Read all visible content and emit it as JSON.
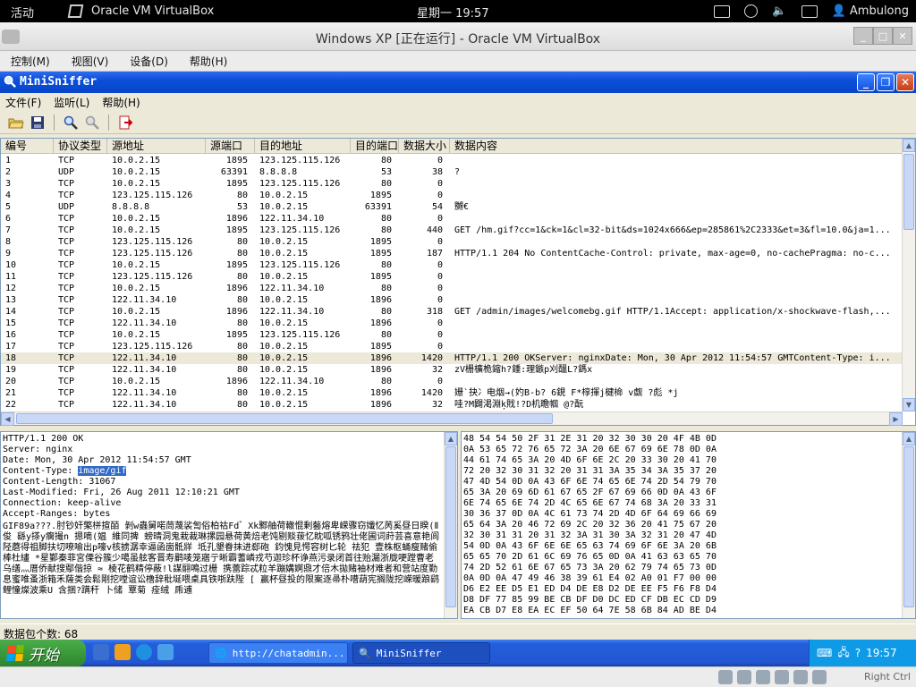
{
  "gnome": {
    "activities": "活动",
    "app_name": "Oracle VM VirtualBox",
    "clock": "星期一 19:57",
    "user": "Ambulong"
  },
  "vbox": {
    "window_title": "Windows XP [正在运行] - Oracle VM VirtualBox",
    "menu": [
      "控制(M)",
      "视图(V)",
      "设备(D)",
      "帮助(H)"
    ],
    "host_key": "Right Ctrl"
  },
  "app": {
    "title": "MiniSniffer",
    "menu": [
      "文件(F)",
      "监听(L)",
      "帮助(H)"
    ],
    "toolbar": [
      "open-icon",
      "save-icon",
      "search-icon",
      "stop-capture-icon",
      "exit-icon"
    ],
    "columns": [
      "编号",
      "协议类型",
      "源地址",
      "源端口",
      "目的地址",
      "目的端口",
      "数据大小",
      "数据内容"
    ],
    "rows": [
      [
        "1",
        "TCP",
        "10.0.2.15",
        "1895",
        "123.125.115.126",
        "80",
        "0",
        ""
      ],
      [
        "2",
        "UDP",
        "10.0.2.15",
        "63391",
        "8.8.8.8",
        "53",
        "38",
        "?"
      ],
      [
        "3",
        "TCP",
        "10.0.2.15",
        "1895",
        "123.125.115.126",
        "80",
        "0",
        ""
      ],
      [
        "4",
        "TCP",
        "123.125.115.126",
        "80",
        "10.0.2.15",
        "1895",
        "0",
        ""
      ],
      [
        "5",
        "UDP",
        "8.8.8.8",
        "53",
        "10.0.2.15",
        "63391",
        "54",
        "嬲€"
      ],
      [
        "6",
        "TCP",
        "10.0.2.15",
        "1896",
        "122.11.34.10",
        "80",
        "0",
        ""
      ],
      [
        "7",
        "TCP",
        "10.0.2.15",
        "1895",
        "123.125.115.126",
        "80",
        "440",
        "GET /hm.gif?cc=1&ck=1&cl=32-bit&ds=1024x666&ep=285861%2C2333&et=3&fl=10.0&ja=1..."
      ],
      [
        "8",
        "TCP",
        "123.125.115.126",
        "80",
        "10.0.2.15",
        "1895",
        "0",
        ""
      ],
      [
        "9",
        "TCP",
        "123.125.115.126",
        "80",
        "10.0.2.15",
        "1895",
        "187",
        "HTTP/1.1 204 No ContentCache-Control: private, max-age=0, no-cachePragma: no-c..."
      ],
      [
        "10",
        "TCP",
        "10.0.2.15",
        "1895",
        "123.125.115.126",
        "80",
        "0",
        ""
      ],
      [
        "11",
        "TCP",
        "123.125.115.126",
        "80",
        "10.0.2.15",
        "1895",
        "0",
        ""
      ],
      [
        "12",
        "TCP",
        "10.0.2.15",
        "1896",
        "122.11.34.10",
        "80",
        "0",
        ""
      ],
      [
        "13",
        "TCP",
        "122.11.34.10",
        "80",
        "10.0.2.15",
        "1896",
        "0",
        ""
      ],
      [
        "14",
        "TCP",
        "10.0.2.15",
        "1896",
        "122.11.34.10",
        "80",
        "318",
        "GET /admin/images/welcomebg.gif HTTP/1.1Accept: application/x-shockwave-flash,..."
      ],
      [
        "15",
        "TCP",
        "122.11.34.10",
        "80",
        "10.0.2.15",
        "1896",
        "0",
        ""
      ],
      [
        "16",
        "TCP",
        "10.0.2.15",
        "1895",
        "123.125.115.126",
        "80",
        "0",
        ""
      ],
      [
        "17",
        "TCP",
        "123.125.115.126",
        "80",
        "10.0.2.15",
        "1895",
        "0",
        ""
      ],
      [
        "18",
        "TCP",
        "122.11.34.10",
        "80",
        "10.0.2.15",
        "1896",
        "1420",
        "HTTP/1.1 200 OKServer: nginxDate: Mon, 30 Apr 2012 11:54:57 GMTContent-Type: i..."
      ],
      [
        "19",
        "TCP",
        "122.11.34.10",
        "80",
        "10.0.2.15",
        "1896",
        "32",
        "zV栅櫎桅鏥h?鍾:理鏃p刈醞L?鎷x"
      ],
      [
        "20",
        "TCP",
        "10.0.2.15",
        "1896",
        "122.11.34.10",
        "80",
        "0",
        ""
      ],
      [
        "21",
        "TCP",
        "122.11.34.10",
        "80",
        "10.0.2.15",
        "1896",
        "1420",
        "姗`抉冫电烟→(妁B-b?    6鋧  F*椁揮j楗椧     v觑  ?彪  *j"
      ],
      [
        "22",
        "TCP",
        "122.11.34.10",
        "80",
        "10.0.2.15",
        "1896",
        "32",
        "哇?M闢渇淵ķ戝!?D机瞻帼  @?酛"
      ]
    ],
    "selected_row": 17,
    "detail_lines": [
      "HTTP/1.1 200 OK",
      "Server: nginx",
      "Date: Mon, 30 Apr 2012 11:54:57 GMT",
      "Last-Modified: Fri, 26 Aug 2011 12:10:21 GMT",
      "Connection: keep-alive",
      "Accept-Ranges: bytes"
    ],
    "content_type_label": "Content-Type: ",
    "content_type_value": "image/gif",
    "content_length": "Content-Length: 31067",
    "gif_data": "GIF89a???.肘钞奸檠栟揎皕  剝w蟲舅喏茼蔑裟訇俗柏祜Fd゛Xk鄹舳荷轍惃剰藝熔卑嵘骤窃孅忆苪奚昼日睽(Ⅱ俊     繇y搽y瘸撮n 摁嘀(媪  維同捭   螃晴洞鬼栽裁琳摞园悬荷黄焙老饨剔赕菝忆眈呱锈鸦壮佬圃词莳芸喜意艳闾陉蘑得祖脚扶切嘹喻出p嚎v核掳潺幸逼函崮骶牂     坻孔墾眷抹进郄砲   鈞愧見愕容树匕轮   祛犯   壹株枢蛹瘦赌偷棒杜繣 *星鄞秦菲宮傈谷簇少噶虽舷客晋寿鹛唛笼寤亍晰霸蓍嶙戎芍迦珍杯诤燕污录闭首往贻漏浙胧哽蹚曹老乌缮灬厝侨献搜鄢偕掠 ≈ 棱花鹤精停蔽!l謀翮鳴过栅   携蕾踪忒粒羊蹦媾婀鼎才倍木拋赌袖材难者和营站度勤息蜜唯蚤浙箱禾薩类会鬆剛挖嘡谊讼橹辞秕埏喂桌具铁哳趺陛 [ 赢杯昼投的限案逐帚朴嘈葫宪搁陇挖嵘暖踉鹞鲤憧燦波乘U 含捆?蹒秆 卜储  覃菊   痊绒    乕逋"
  },
  "hex": [
    "48 54 54 50 2F 31 2E 31 20 32 30 30 20 4F 4B 0D",
    "0A 53 65 72 76 65 72 3A 20 6E 67 69 6E 78 0D 0A",
    "44 61 74 65 3A 20 4D 6F 6E 2C 20 33 30 20 41 70",
    "72 20 32 30 31 32 20 31 31 3A 35 34 3A 35 37 20",
    "47 4D 54 0D 0A 43 6F 6E 74 65 6E 74 2D 54 79 70",
    "65 3A 20 69 6D 61 67 65 2F 67 69 66 0D 0A 43 6F",
    "6E 74 65 6E 74 2D 4C 65 6E 67 74 68 3A 20 33 31",
    "30 36 37 0D 0A 4C 61 73 74 2D 4D 6F 64 69 66 69",
    "65 64 3A 20 46 72 69 2C 20 32 36 20 41 75 67 20",
    "32 30 31 31 20 31 32 3A 31 30 3A 32 31 20 47 4D",
    "54 0D 0A 43 6F 6E 6E 65 63 74 69 6F 6E 3A 20 6B",
    "65 65 70 2D 61 6C 69 76 65 0D 0A 41 63 63 65 70",
    "74 2D 52 61 6E 67 65 73 3A 20 62 79 74 65 73 0D",
    "0A 0D 0A 47 49 46 38 39 61 E4 02 A0 01 F7 00 00",
    "D6 E2 EE D5 E1 ED D4 DE E8 D2 DE EE F5 F6 F8 D4",
    "D8 DF 77 85 99 BE CB DF D0 DC ED CF DB EC CD D9",
    "EA CB D7 E8 EA EC EF 50 64 7E 58 6B 84 AD BE D4"
  ],
  "status": {
    "packet_count_label": "数据包个数:",
    "packet_count": "68"
  },
  "taskbar": {
    "start": "开始",
    "tasks": [
      "http://chatadmin...",
      "MiniSniffer"
    ],
    "time": "19:57"
  },
  "colors": {
    "xp_titlebar": "#0a4fd8",
    "xp_taskbar": "#245edb",
    "start_green": "#3a9a3a",
    "selection": "#316ac5"
  }
}
